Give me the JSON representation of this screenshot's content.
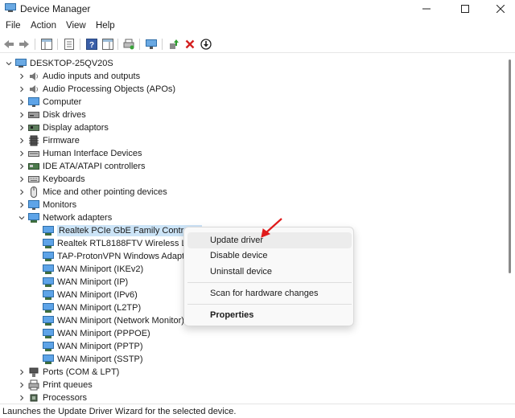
{
  "window": {
    "title": "Device Manager"
  },
  "menu": [
    "File",
    "Action",
    "View",
    "Help"
  ],
  "tree": {
    "root": "DESKTOP-25QV20S",
    "categories": [
      {
        "label": "Audio inputs and outputs",
        "icon": "speaker-icon"
      },
      {
        "label": "Audio Processing Objects (APOs)",
        "icon": "speaker-icon"
      },
      {
        "label": "Computer",
        "icon": "monitor-icon"
      },
      {
        "label": "Disk drives",
        "icon": "disk-icon"
      },
      {
        "label": "Display adaptors",
        "icon": "display-adapter-icon"
      },
      {
        "label": "Firmware",
        "icon": "firmware-icon"
      },
      {
        "label": "Human Interface Devices",
        "icon": "hid-icon"
      },
      {
        "label": "IDE ATA/ATAPI controllers",
        "icon": "ide-icon"
      },
      {
        "label": "Keyboards",
        "icon": "keyboard-icon"
      },
      {
        "label": "Mice and other pointing devices",
        "icon": "mouse-icon"
      },
      {
        "label": "Monitors",
        "icon": "monitor-icon"
      },
      {
        "label": "Network adapters",
        "icon": "network-icon"
      }
    ],
    "network_children": [
      "Realtek PCIe GbE Family Controller",
      "Realtek RTL8188FTV Wireless LAN",
      "TAP-ProtonVPN Windows Adapter",
      "WAN Miniport (IKEv2)",
      "WAN Miniport (IP)",
      "WAN Miniport (IPv6)",
      "WAN Miniport (L2TP)",
      "WAN Miniport (Network Monitor)",
      "WAN Miniport (PPPOE)",
      "WAN Miniport (PPTP)",
      "WAN Miniport (SSTP)"
    ],
    "after": [
      {
        "label": "Ports (COM & LPT)",
        "icon": "port-icon"
      },
      {
        "label": "Print queues",
        "icon": "printer-icon"
      },
      {
        "label": "Processors",
        "icon": "processor-icon"
      }
    ]
  },
  "context_menu": {
    "update": "Update driver",
    "disable": "Disable device",
    "uninstall": "Uninstall device",
    "scan": "Scan for hardware changes",
    "properties": "Properties"
  },
  "status": "Launches the Update Driver Wizard for the selected device.",
  "colors": {
    "selection": "#cce4f7",
    "arrow": "#e01b1b",
    "remove": "#d42020"
  }
}
